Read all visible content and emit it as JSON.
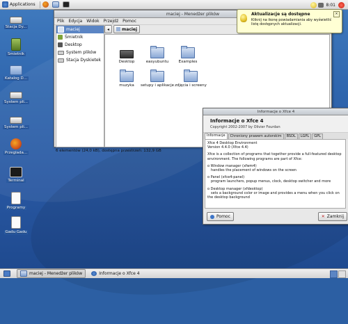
{
  "top_panel": {
    "applications_label": "Applications",
    "time": "8:01"
  },
  "desktop_icons": [
    {
      "label": "Stacja Dy...",
      "icon": "floppy-drive-icon"
    },
    {
      "label": "Śmietnik",
      "icon": "trash-icon"
    },
    {
      "label": "Katalog D...",
      "icon": "home-folder-icon"
    },
    {
      "label": "System pli...",
      "icon": "drive-icon"
    },
    {
      "label": "System pli...",
      "icon": "drive-icon"
    },
    {
      "label": "Przeglada...",
      "icon": "firefox-icon"
    },
    {
      "label": "Terminal",
      "icon": "terminal-icon"
    },
    {
      "label": "Programy",
      "icon": "document-icon"
    },
    {
      "label": "Gadu Gadu",
      "icon": "document-icon"
    }
  ],
  "file_manager": {
    "title": "maciej - Menedżer plików",
    "menu": [
      "Plik",
      "Edycja",
      "Widok",
      "Przejdź",
      "Pomoc"
    ],
    "sidebar": [
      "maciej",
      "Śmietnik",
      "Desktop",
      "System plików",
      "Stacja Dyskietek"
    ],
    "path_button": "maciej",
    "items": [
      {
        "label": "Desktop",
        "icon": "desktop-folder-icon"
      },
      {
        "label": "easyubuntu",
        "icon": "folder-icon"
      },
      {
        "label": "Examples",
        "icon": "examples-folder-icon"
      },
      {
        "label": "muzyka",
        "icon": "folder-icon"
      },
      {
        "label": "setupy i aplikacje",
        "icon": "folder-icon"
      },
      {
        "label": "zdjęcia i screeny",
        "icon": "folder-icon"
      }
    ],
    "status": "6 elementów (24,0 kB), dostępna przestrzeń: 132,9 GB"
  },
  "notification": {
    "title": "Aktualizacje są dostępne",
    "body": "Kliknij na ikonę powiadamiania aby wyświetlić listę dostępnych aktualizacji."
  },
  "about": {
    "title": "Informacje o Xfce 4",
    "heading": "Informacje o Xfce 4",
    "copyright": "Copyright 2002-2007 by Olivier Fourdan",
    "tabs": [
      "Informacje",
      "Chroniony prawem autorskim",
      "BSDL",
      "LGPL",
      "GPL"
    ],
    "body_lines": [
      "Xfce 4 Desktop Environment",
      "Version 4.4.0 (Xfce 4.4)",
      "Xfce is a collection of programs that together provide a full-featured desktop environment. The following programs are part of Xfce:",
      "o Window manager (xfwm4)",
      "handles the placement of windows on the screen",
      "o Panel (xfce4-panel)",
      "program launchers, popup menus, clock, desktop switcher and more",
      "o Desktop manager (xfdesktop)",
      "sets a background color or image and provides a menu when you click on the desktop background"
    ],
    "help_button": "Pomoc",
    "close_button": "Zamknij"
  },
  "taskbar": [
    {
      "label": "maciej - Menedżer plików",
      "active": true
    },
    {
      "label": "Informacje o Xfce 4",
      "active": false
    }
  ]
}
